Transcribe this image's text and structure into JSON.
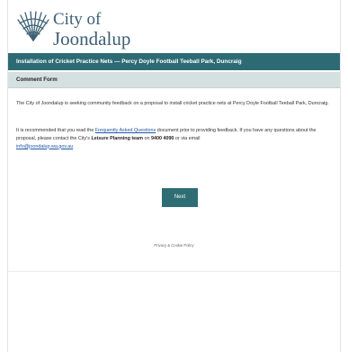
{
  "header": {
    "logo_line1": "City of",
    "logo_line2": "Joondalup",
    "logo_icon": "leaf-fan-icon",
    "brand_color": "#3c5f74"
  },
  "title_bar": {
    "text": "Installation of Cricket Practice Nets — Percy Doyle Football Teeball Park, Duncraig",
    "bg_color": "#2c6b73"
  },
  "section": {
    "title": "Comment Form",
    "bg_color": "#d5e1e1"
  },
  "body": {
    "para1": "The City of Joondalup is seeking community feedback on a proposal to install cricket practice nets at Percy Doyle Football Teeball Park, Duncraig.",
    "para2_a": "It is recommended that you read the ",
    "para2_link": "Frequently Asked Questions",
    "para2_b": " document prior to providing feedback. If you have any questions about the proposal, please contact the City's ",
    "para2_strong1": "Leisure Planning team",
    "para2_c": " on ",
    "para2_strong2": "9400 4090",
    "para2_d": " or via email ",
    "para2_email": "info@joondalup.wa.gov.au"
  },
  "actions": {
    "next_label": "Next"
  },
  "footer": {
    "privacy_label": "Privacy & Cookie Policy"
  }
}
